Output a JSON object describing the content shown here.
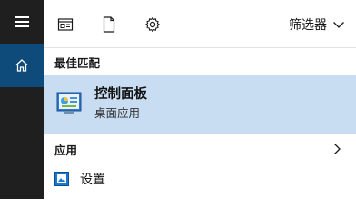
{
  "toolbar": {
    "filter_label": "筛选器",
    "icons": [
      "apps-icon",
      "document-icon",
      "gear-icon"
    ]
  },
  "rail": {
    "icons": [
      "hamburger-menu-icon",
      "home-icon"
    ]
  },
  "best_match": {
    "heading": "最佳匹配",
    "title": "控制面板",
    "subtitle": "桌面应用"
  },
  "apps": {
    "heading": "应用"
  },
  "results": [
    {
      "label": "设置",
      "icon": "settings-app-icon"
    }
  ],
  "colors": {
    "rail_bg": "#1f1f1f",
    "rail_active": "#0e4a7a",
    "selected_bg": "#c9ddf2",
    "accent": "#0078d7"
  }
}
